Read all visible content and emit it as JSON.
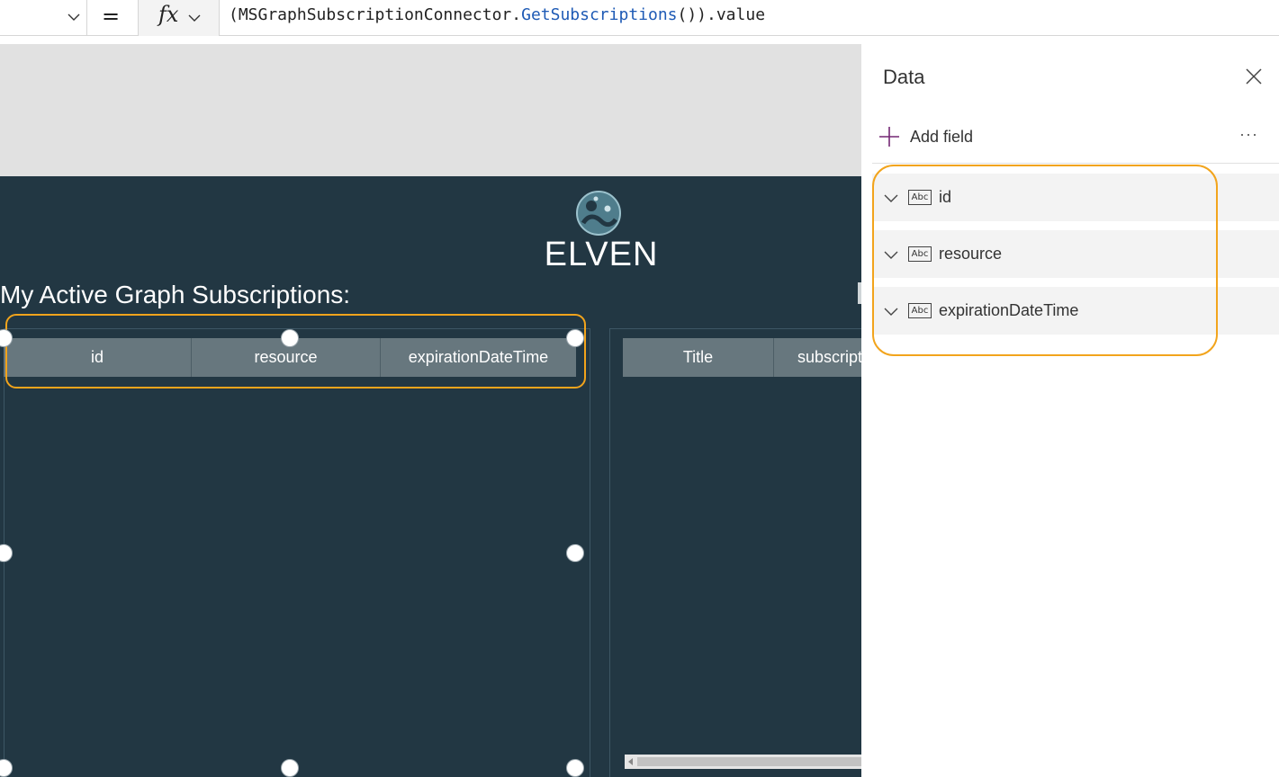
{
  "formula_bar": {
    "equals": "=",
    "fx": "fx",
    "formula_prefix": "(MSGraphSubscriptionConnector.",
    "formula_function": "GetSubscriptions",
    "formula_suffix": "()).value"
  },
  "screen": {
    "logo_text": "ELVEN",
    "title": "My Active Graph Subscriptions:",
    "subscriptions_grid": {
      "columns": [
        "id",
        "resource",
        "expirationDateTime"
      ]
    },
    "second_grid": {
      "columns": [
        "Title",
        "subscript"
      ]
    }
  },
  "data_pane": {
    "title": "Data",
    "add_field": "Add field",
    "more": "···",
    "type_badge": "Abc",
    "fields": [
      {
        "name": "id"
      },
      {
        "name": "resource"
      },
      {
        "name": "expirationDateTime"
      }
    ]
  },
  "colors": {
    "canvas_bg": "#223743",
    "header_bg": "#67777e",
    "highlight": "#f2a41c",
    "formula_fn": "#1e5ab5"
  }
}
